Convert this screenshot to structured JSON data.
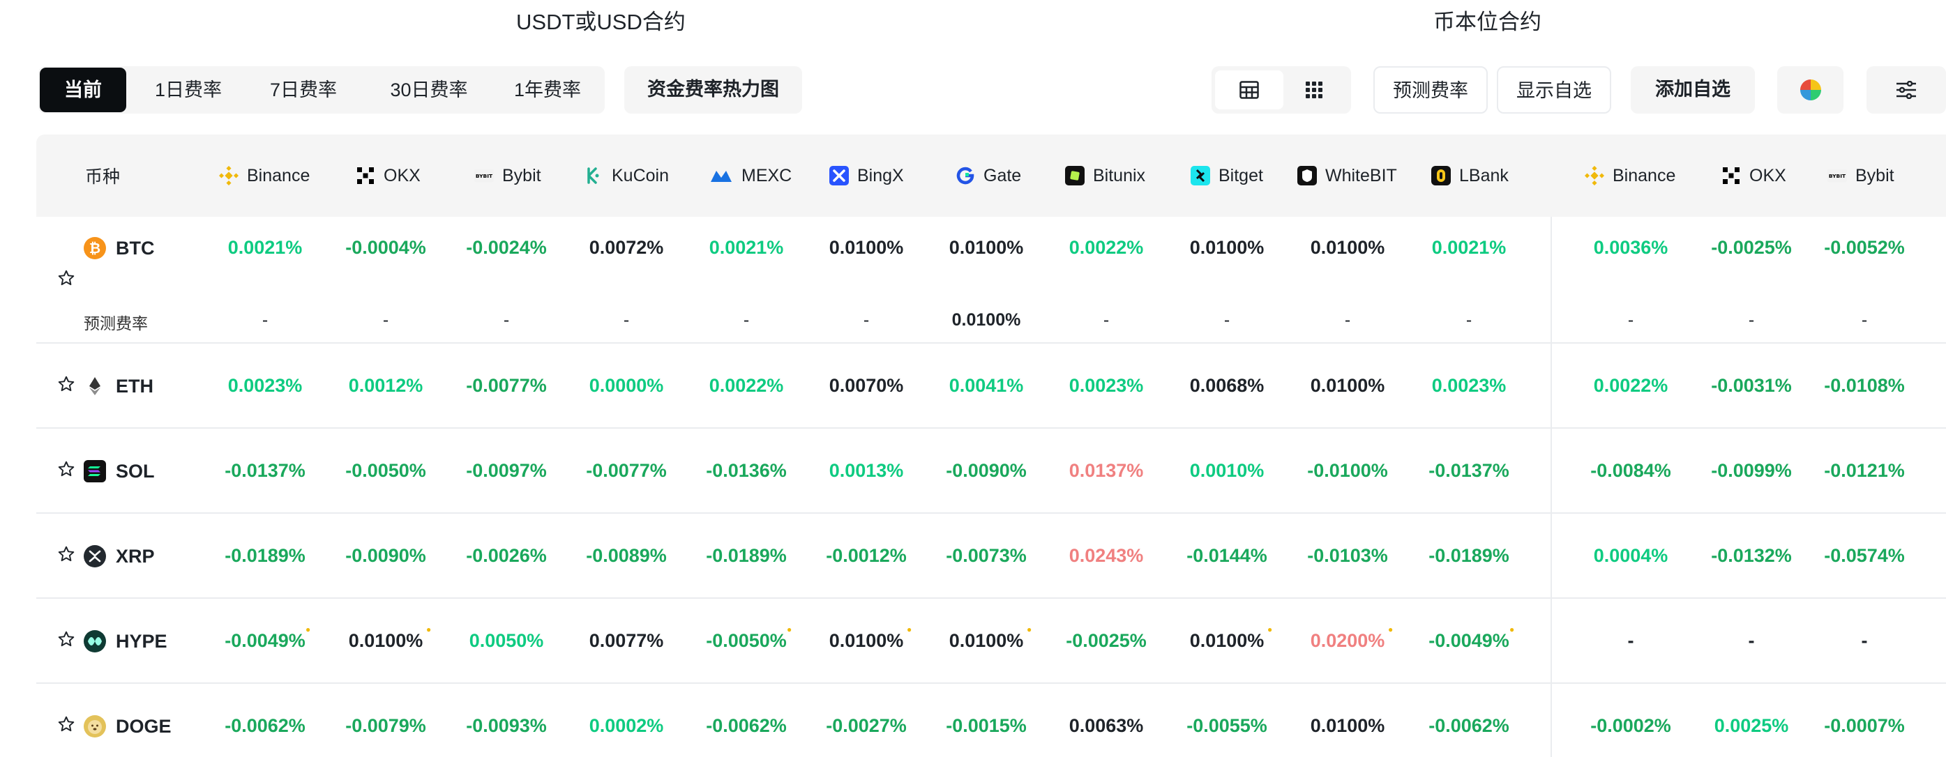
{
  "sections": {
    "usdt": "USDT或USD合约",
    "coin": "币本位合约"
  },
  "toolbar": {
    "periods": [
      "当前",
      "1日费率",
      "7日费率",
      "30日费率",
      "1年费率"
    ],
    "heatmap": "资金费率热力图",
    "forecast": "预测费率",
    "show_watch": "显示自选",
    "add_watch": "添加自选"
  },
  "header": {
    "coin_col": "币种",
    "exchanges": [
      "Binance",
      "OKX",
      "Bybit",
      "KuCoin",
      "MEXC",
      "BingX",
      "Gate",
      "Bitunix",
      "Bitget",
      "WhiteBIT",
      "LBank",
      "Binance",
      "OKX",
      "Bybit"
    ]
  },
  "forecast_label": "预测费率",
  "colors": {
    "green": "#1aa85c",
    "teal": "#0ecb81",
    "red": "#f08080",
    "dark": "#1e2329"
  },
  "rows": [
    {
      "coin": "BTC",
      "values": [
        "0.0021%",
        "-0.0004%",
        "-0.0024%",
        "0.0072%",
        "0.0021%",
        "0.0100%",
        "0.0100%",
        "0.0022%",
        "0.0100%",
        "0.0100%",
        "0.0021%",
        "0.0036%",
        "-0.0025%",
        "-0.0052%"
      ],
      "colors": [
        "teal",
        "green",
        "green",
        "dark",
        "teal",
        "dark",
        "dark",
        "teal",
        "dark",
        "dark",
        "teal",
        "teal",
        "green",
        "green"
      ],
      "forecast": [
        "-",
        "-",
        "-",
        "-",
        "-",
        "-",
        "0.0100%",
        "-",
        "-",
        "-",
        "-",
        "-",
        "-",
        "-"
      ]
    },
    {
      "coin": "ETH",
      "values": [
        "0.0023%",
        "0.0012%",
        "-0.0077%",
        "0.0000%",
        "0.0022%",
        "0.0070%",
        "0.0041%",
        "0.0023%",
        "0.0068%",
        "0.0100%",
        "0.0023%",
        "0.0022%",
        "-0.0031%",
        "-0.0108%"
      ],
      "colors": [
        "teal",
        "teal",
        "green",
        "teal",
        "teal",
        "dark",
        "teal",
        "teal",
        "dark",
        "dark",
        "teal",
        "teal",
        "green",
        "green"
      ]
    },
    {
      "coin": "SOL",
      "values": [
        "-0.0137%",
        "-0.0050%",
        "-0.0097%",
        "-0.0077%",
        "-0.0136%",
        "0.0013%",
        "-0.0090%",
        "0.0137%",
        "0.0010%",
        "-0.0100%",
        "-0.0137%",
        "-0.0084%",
        "-0.0099%",
        "-0.0121%"
      ],
      "colors": [
        "green",
        "green",
        "green",
        "green",
        "green",
        "teal",
        "green",
        "red",
        "teal",
        "green",
        "green",
        "green",
        "green",
        "green"
      ]
    },
    {
      "coin": "XRP",
      "values": [
        "-0.0189%",
        "-0.0090%",
        "-0.0026%",
        "-0.0089%",
        "-0.0189%",
        "-0.0012%",
        "-0.0073%",
        "0.0243%",
        "-0.0144%",
        "-0.0103%",
        "-0.0189%",
        "0.0004%",
        "-0.0132%",
        "-0.0574%"
      ],
      "colors": [
        "green",
        "green",
        "green",
        "green",
        "green",
        "green",
        "green",
        "red",
        "green",
        "green",
        "green",
        "teal",
        "green",
        "green"
      ]
    },
    {
      "coin": "HYPE",
      "values": [
        "-0.0049%",
        "0.0100%",
        "0.0050%",
        "0.0077%",
        "-0.0050%",
        "0.0100%",
        "0.0100%",
        "-0.0025%",
        "0.0100%",
        "0.0200%",
        "-0.0049%",
        "-",
        "-",
        "-"
      ],
      "colors": [
        "green",
        "dark",
        "teal",
        "dark",
        "green",
        "dark",
        "dark",
        "green",
        "dark",
        "red",
        "green",
        "dark",
        "dark",
        "dark"
      ],
      "marks": [
        true,
        true,
        false,
        false,
        true,
        true,
        true,
        false,
        true,
        true,
        true,
        false,
        false,
        false
      ]
    },
    {
      "coin": "DOGE",
      "values": [
        "-0.0062%",
        "-0.0079%",
        "-0.0093%",
        "0.0002%",
        "-0.0062%",
        "-0.0027%",
        "-0.0015%",
        "0.0063%",
        "-0.0055%",
        "0.0100%",
        "-0.0062%",
        "-0.0002%",
        "0.0025%",
        "-0.0007%"
      ],
      "colors": [
        "green",
        "green",
        "green",
        "teal",
        "green",
        "green",
        "green",
        "dark",
        "green",
        "dark",
        "green",
        "green",
        "teal",
        "green"
      ]
    }
  ]
}
